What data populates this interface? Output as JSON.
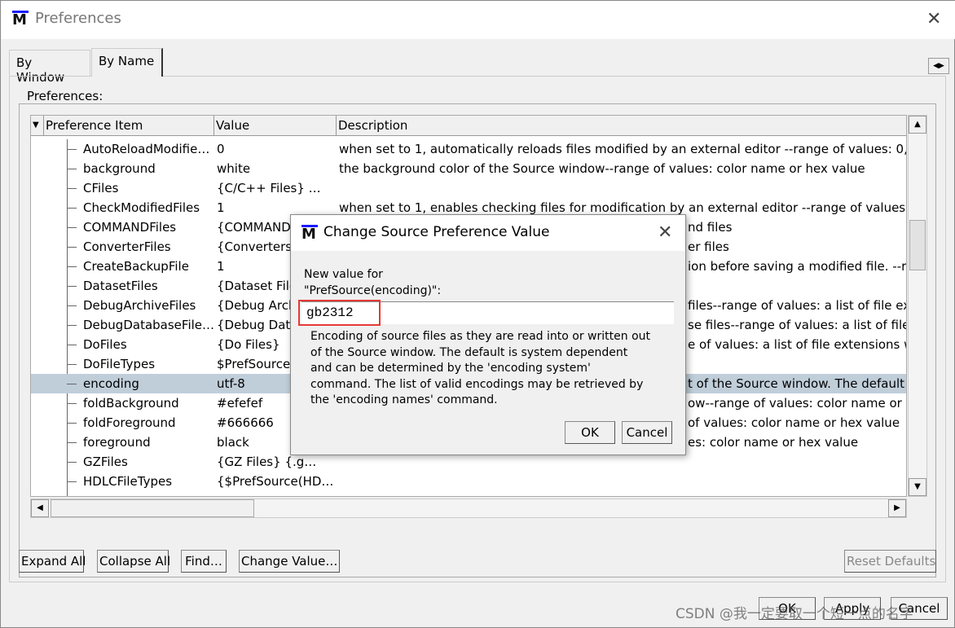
{
  "window": {
    "title": "Preferences",
    "close": "✕",
    "tab_scroll": "◀▶"
  },
  "tabs": [
    {
      "label": "By Window",
      "active": false
    },
    {
      "label": "By Name",
      "active": true
    }
  ],
  "group_label": "Preferences:",
  "table": {
    "columns": [
      "Preference Item",
      "Value",
      "Description"
    ],
    "rows": [
      {
        "name": "AutoReloadModifie…",
        "value": "0",
        "desc": "when set to 1, automatically reloads files modified by an external editor --range of values: 0, 1"
      },
      {
        "name": "background",
        "value": "white",
        "desc": "the background color of the Source window--range of values: color name or hex value"
      },
      {
        "name": "CFiles",
        "value": "{C/C++ Files}    …",
        "desc": ""
      },
      {
        "name": "CheckModifiedFiles",
        "value": "1",
        "desc": "when set to 1, enables checking files for modification by an external editor --range of values: 0, 1"
      },
      {
        "name": "COMMANDFiles",
        "value": "{COMMAND",
        "desc_tail": "nd files"
      },
      {
        "name": "ConverterFiles",
        "value": "{Converters}",
        "desc_tail": "er files"
      },
      {
        "name": "CreateBackupFile",
        "value": "1",
        "desc_tail": "ion before saving a modified file. --range"
      },
      {
        "name": "DatasetFiles",
        "value": "{Dataset File",
        "desc_tail": ""
      },
      {
        "name": "DebugArchiveFiles",
        "value": "{Debug Arch",
        "desc_tail": "files--range of values: a list of file ext"
      },
      {
        "name": "DebugDatabaseFile…",
        "value": "{Debug Data",
        "desc_tail": "se files--range of values: a list of file e"
      },
      {
        "name": "DoFiles",
        "value": "{Do Files}",
        "desc_tail": "e of values: a list of file extensions with"
      },
      {
        "name": "DoFileTypes",
        "value": " $PrefSource",
        "desc_tail": ""
      },
      {
        "name": "encoding",
        "value": "utf-8",
        "desc_tail": "t of the Source window. The default is",
        "selected": true
      },
      {
        "name": "foldBackground",
        "value": "#efefef",
        "desc_tail": "ow--range of values: color name or hex"
      },
      {
        "name": "foldForeground",
        "value": "#666666",
        "desc_tail": "of values: color name or hex value"
      },
      {
        "name": "foreground",
        "value": "black",
        "desc_tail": "es: color name or hex value"
      },
      {
        "name": "GZFiles",
        "value": "{GZ Files}    {.g…",
        "desc": ""
      },
      {
        "name": "HDLCFileTypes",
        "value": "{$PrefSource(HD…",
        "desc": ""
      }
    ]
  },
  "buttons": {
    "expand_all": "Expand All",
    "collapse_all": "Collapse All",
    "find": "Find…",
    "change_value": "Change Value…",
    "reset_defaults": "Reset Defaults",
    "ok": "OK",
    "apply": "Apply",
    "cancel": "Cancel"
  },
  "dialog": {
    "title": "Change Source Preference Value",
    "label_line1": "New value for",
    "label_line2": "\"PrefSource(encoding)\":",
    "value": "gb2312",
    "help": "Encoding of source files as they are read into or written out of the Source window. The default is system dependent and can be determined by the 'encoding system' command. The list of valid encodings may be retrieved by the 'encoding names' command.",
    "ok": "OK",
    "cancel": "Cancel",
    "close": "✕"
  },
  "watermark": "CSDN @我一定要取一个短一点的名字",
  "colors": {
    "selection": "#c0ceda",
    "highlight_box": "#e53935",
    "logo_bar": "#1a1aff"
  }
}
